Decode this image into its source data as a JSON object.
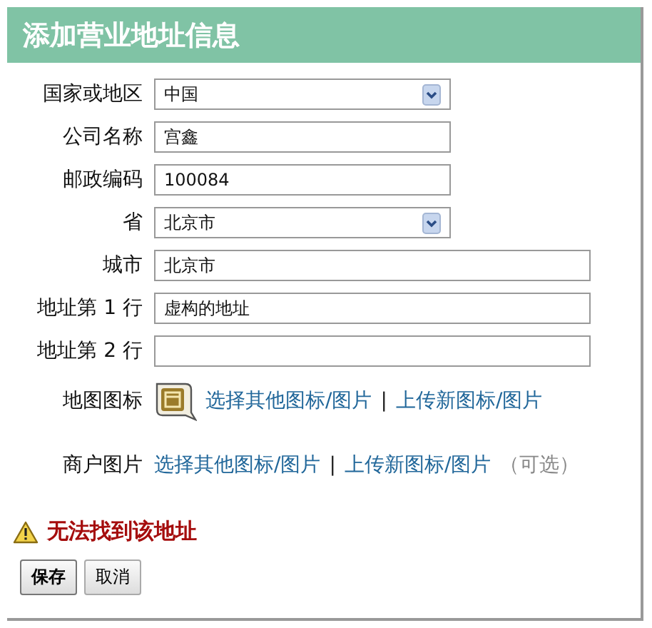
{
  "title": "添加营业地址信息",
  "fields": [
    {
      "label": "国家或地区",
      "kind": "select",
      "value": "中国"
    },
    {
      "label": "公司名称",
      "kind": "short",
      "value": "宫鑫"
    },
    {
      "label": "邮政编码",
      "kind": "short",
      "value": "100084"
    },
    {
      "label": "省",
      "kind": "select",
      "value": "北京市"
    },
    {
      "label": "城市",
      "kind": "long",
      "value": "北京市"
    },
    {
      "label": "地址第 1 行",
      "kind": "long",
      "value": "虚构的地址"
    },
    {
      "label": "地址第 2 行",
      "kind": "long"
    }
  ],
  "images": [
    {
      "label": "地图图标",
      "kind": "icon",
      "links": [
        "选择其他图标/图片",
        "上传新图标/图片"
      ],
      "separator": "|"
    },
    {
      "label": "商户图片",
      "kind": "plain",
      "links": [
        "选择其他图标/图片",
        "上传新图标/图片"
      ],
      "separator": "|",
      "note": "（可选）"
    }
  ],
  "error": "无法找到该地址",
  "buttons": [
    {
      "label": "保存",
      "kind": "primary"
    },
    {
      "label": "取消",
      "kind": "secondary"
    }
  ]
}
